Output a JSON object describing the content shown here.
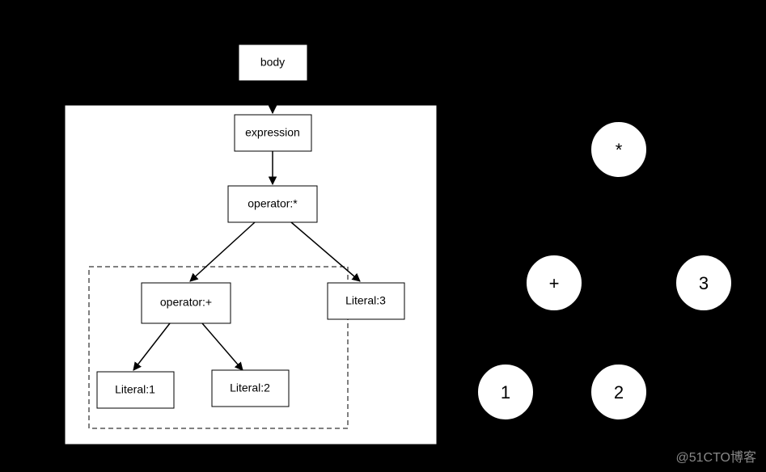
{
  "left_tree": {
    "body": "body",
    "expression": "expression",
    "op_mul": "operator:*",
    "op_add": "operator:+",
    "lit1": "Literal:1",
    "lit2": "Literal:2",
    "lit3": "Literal:3"
  },
  "right_tree": {
    "mul": "*",
    "add": "+",
    "n1": "1",
    "n2": "2",
    "n3": "3"
  },
  "watermark": "@51CTO博客",
  "chart_data": [
    {
      "type": "tree",
      "title": "AST (detailed)",
      "nodes": [
        {
          "id": "body",
          "label": "body"
        },
        {
          "id": "expression",
          "label": "expression"
        },
        {
          "id": "op_mul",
          "label": "operator:*"
        },
        {
          "id": "op_add",
          "label": "operator:+"
        },
        {
          "id": "lit3",
          "label": "Literal:3"
        },
        {
          "id": "lit1",
          "label": "Literal:1"
        },
        {
          "id": "lit2",
          "label": "Literal:2"
        }
      ],
      "edges": [
        [
          "body",
          "expression"
        ],
        [
          "expression",
          "op_mul"
        ],
        [
          "op_mul",
          "op_add"
        ],
        [
          "op_mul",
          "lit3"
        ],
        [
          "op_add",
          "lit1"
        ],
        [
          "op_add",
          "lit2"
        ]
      ],
      "groups": [
        {
          "style": "solid",
          "contains": [
            "expression",
            "op_mul",
            "op_add",
            "lit3",
            "lit1",
            "lit2"
          ]
        },
        {
          "style": "dashed",
          "contains": [
            "op_add",
            "lit1",
            "lit2"
          ]
        }
      ]
    },
    {
      "type": "tree",
      "title": "Expression tree (simplified)",
      "nodes": [
        {
          "id": "mul",
          "label": "*"
        },
        {
          "id": "add",
          "label": "+"
        },
        {
          "id": "n3",
          "label": "3"
        },
        {
          "id": "n1",
          "label": "1"
        },
        {
          "id": "n2",
          "label": "2"
        }
      ],
      "edges": [
        [
          "mul",
          "add"
        ],
        [
          "mul",
          "n3"
        ],
        [
          "add",
          "n1"
        ],
        [
          "add",
          "n2"
        ]
      ]
    }
  ]
}
